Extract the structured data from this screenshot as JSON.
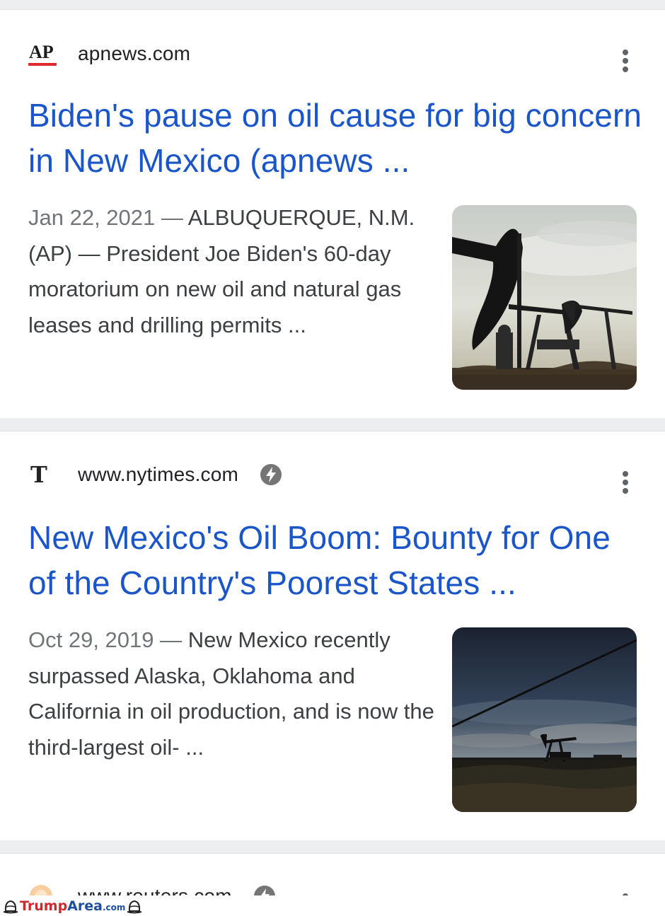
{
  "results": [
    {
      "source": "apnews.com",
      "favicon_text": "AP",
      "title": "Biden's pause on oil cause for big concern in New Mexico (apnews ...",
      "date": "Jan 22, 2021",
      "separator": "—",
      "snippet": "ALBUQUERQUE, N.M. (AP) — President Joe Biden's 60-day moratorium on new oil and natural gas leases and drilling permits ...",
      "image_subject": "oil pumpjacks silhouetted against a cloudy sky",
      "amp": false
    },
    {
      "source": "www.nytimes.com",
      "favicon_text": "T",
      "title": "New Mexico's Oil Boom: Bounty for One of the Country's Poorest States ...",
      "date": "Oct 29, 2019",
      "separator": "—",
      "snippet": "New Mexico recently surpassed Alaska, Oklahoma and California in oil production, and is now the third-largest oil- ...",
      "image_subject": "oil pumpjack on a dusky plain behind a wire fence",
      "amp": true
    },
    {
      "source": "www.reuters.com",
      "amp": true
    }
  ],
  "watermark": {
    "brand_a": "Trump",
    "brand_b": "Area",
    "suffix": ".com"
  },
  "colors": {
    "title_link": "#1a56c9",
    "snippet_text": "#3c4043",
    "date_text": "#70757a",
    "separator_band": "#eceeef",
    "ap_red": "#e0292e",
    "watermark_red": "#d0262c",
    "watermark_blue": "#1d4f9c"
  },
  "icons": [
    "ap-logo-icon",
    "nyt-logo-icon",
    "reuters-logo-icon",
    "amp-lightning-icon",
    "more-vert-icon"
  ]
}
